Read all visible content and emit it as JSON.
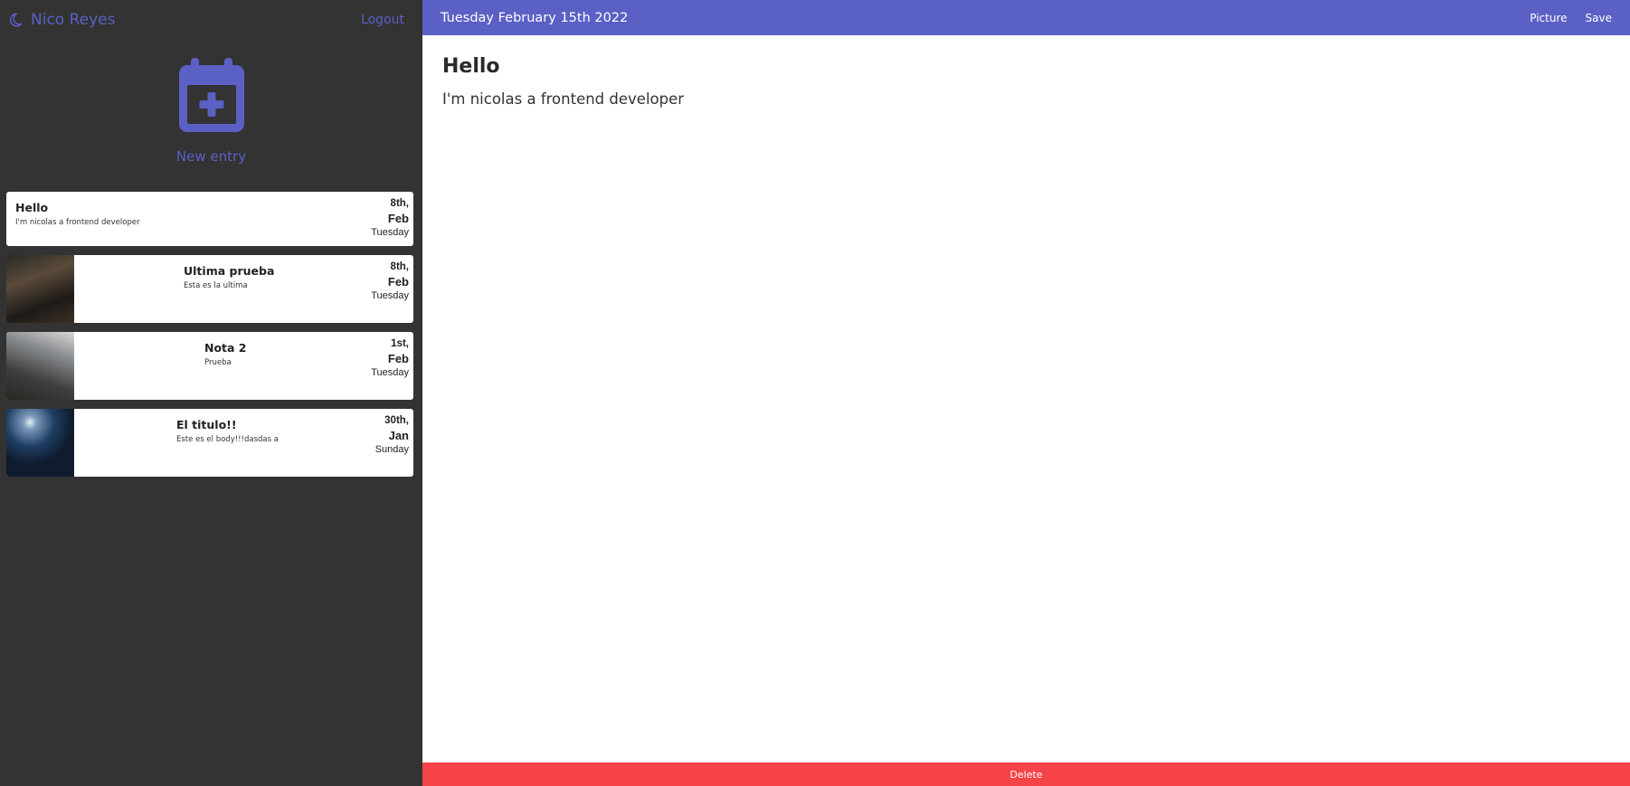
{
  "sidebar": {
    "user_name": "Nico Reyes",
    "logout_label": "Logout",
    "new_entry_label": "New entry",
    "entries": [
      {
        "title": "Hello",
        "snippet": "I'm nicolas a frontend developer",
        "day": "8th,",
        "month": "Feb",
        "weekday": "Tuesday"
      },
      {
        "title": "Ultima prueba",
        "snippet": "Esta es la ultima",
        "day": "8th,",
        "month": "Feb",
        "weekday": "Tuesday"
      },
      {
        "title": "Nota 2",
        "snippet": "Prueba",
        "day": "1st,",
        "month": "Feb",
        "weekday": "Tuesday"
      },
      {
        "title": "El titulo!!",
        "snippet": "Este es el body!!!dasdas a",
        "day": "30th,",
        "month": "Jan",
        "weekday": "Sunday"
      }
    ]
  },
  "topbar": {
    "date": "Tuesday February 15th 2022",
    "picture_label": "Picture",
    "save_label": "Save"
  },
  "note": {
    "title": "Hello",
    "body": "I'm nicolas a frontend developer"
  },
  "footer": {
    "delete_label": "Delete"
  },
  "colors": {
    "accent": "#5b60c4",
    "sidebar_bg": "#333333",
    "danger": "#f64347"
  }
}
